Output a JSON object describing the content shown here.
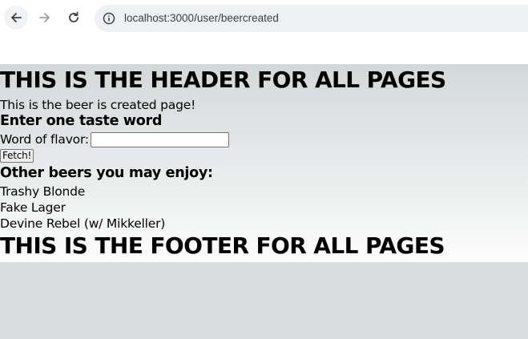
{
  "browser": {
    "url": "localhost:3000/user/beercreated"
  },
  "page": {
    "header": "THIS IS THE HEADER FOR ALL PAGES",
    "intro": "This is the beer is created page!",
    "taste_heading": "Enter one taste word",
    "flavor_label": "Word of flavor:",
    "flavor_value": "",
    "fetch_label": "Fetch!",
    "recommend_heading": "Other beers you may enjoy:",
    "beers": [
      "Trashy Blonde",
      "Fake Lager",
      "Devine Rebel (w/ Mikkeller)"
    ],
    "footer": "THIS IS THE FOOTER FOR ALL PAGES"
  }
}
